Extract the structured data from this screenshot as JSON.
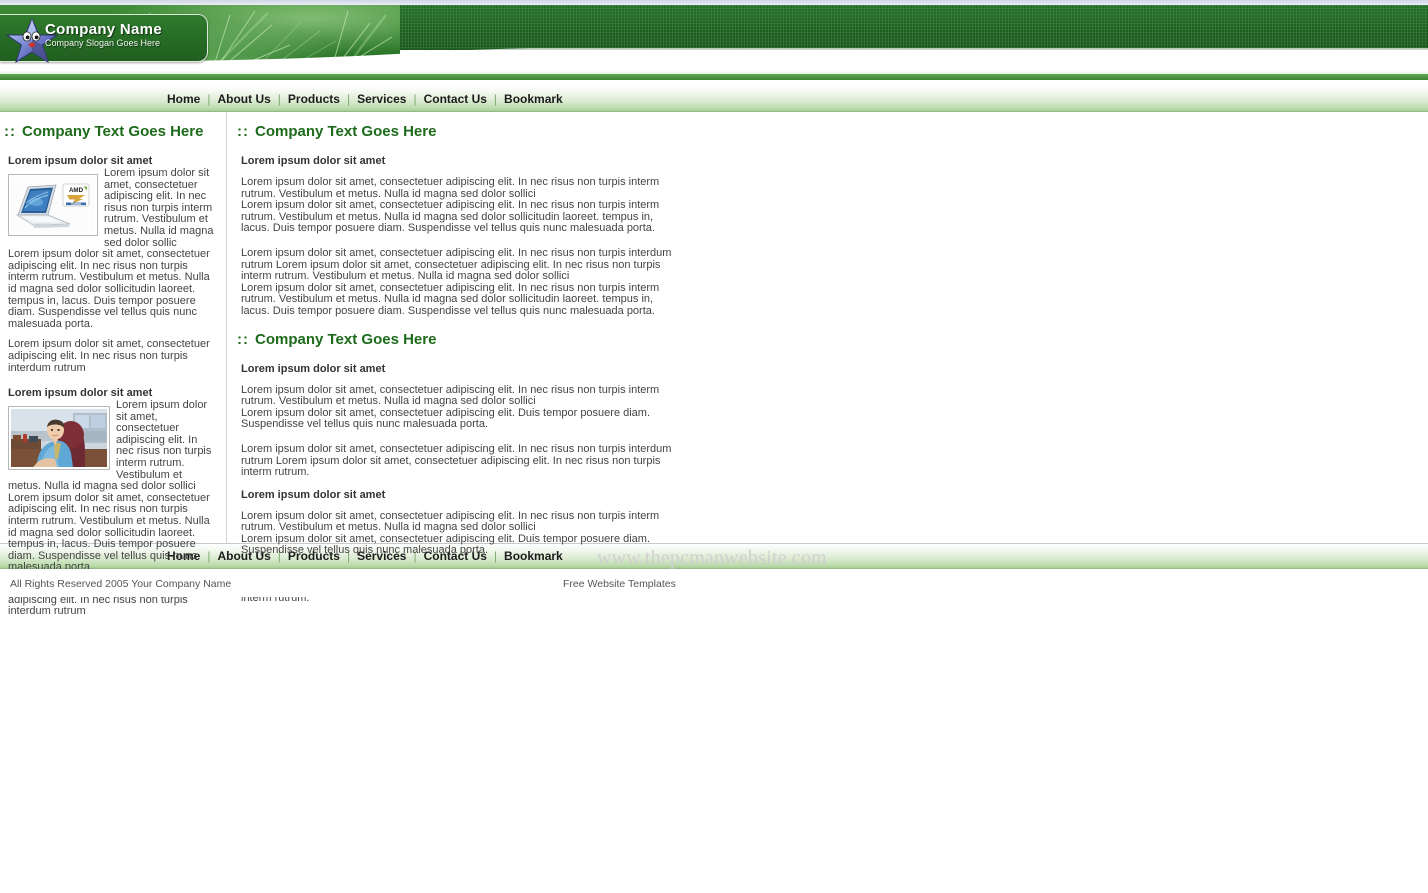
{
  "header": {
    "company_name": "Company Name",
    "company_slogan": "Company Slogan Goes Here",
    "logo_icon": "star-character-logo"
  },
  "nav": {
    "separator": "|",
    "items": [
      {
        "label": "Home"
      },
      {
        "label": "About Us"
      },
      {
        "label": "Products"
      },
      {
        "label": "Services"
      },
      {
        "label": "Contact Us"
      },
      {
        "label": "Bookmark"
      }
    ]
  },
  "left_column": {
    "section_heading": {
      "colons": "::",
      "text": "Company Text Goes Here"
    },
    "block1": {
      "sub_title": "Lorem ipsum dolor sit amet",
      "image_alt": "laptop-with-amd-turion-badge",
      "wrap_text": "Lorem ipsum dolor sit amet, consectetuer adipiscing elit. In nec risus non turpis interm rutrum. Vestibulum et metus. Nulla id magna sed dolor sollic",
      "body_text": "Lorem ipsum dolor sit amet, consectetuer adipiscing elit. In nec risus non turpis interm rutrum. Vestibulum et metus. Nulla id magna sed dolor sollicitudin laoreet. tempus in, lacus. Duis tempor posuere diam. Suspendisse vel tellus quis nunc malesuada porta.",
      "tail_text": "Lorem ipsum dolor sit amet, consectetuer adipiscing elit. In nec risus non turpis interdum rutrum"
    },
    "block2": {
      "sub_title": "Lorem ipsum dolor sit amet",
      "image_alt": "businessman-at-desk",
      "wrap_text": "Lorem ipsum dolor sit amet, consectetuer adipiscing elit. In nec risus non turpis interm rutrum. Vestibulum et metus. Nulla id magna sed dolor sollici",
      "body_text": "Lorem ipsum dolor sit amet, consectetuer adipiscing elit. In nec risus non turpis interm rutrum. Vestibulum et metus. Nulla id magna sed dolor sollicitudin laoreet. tempus in, lacus. Duis tempor posuere diam. Suspendisse vel tellus quis nunc malesuada porta.",
      "tail_text": "Lorem ipsum dolor sit amet, consectetuer adipiscing elit. In nec risus non turpis interdum rutrum"
    }
  },
  "right_column": {
    "section1": {
      "heading": {
        "colons": "::",
        "text": "Company Text Goes Here"
      },
      "sub_title": "Lorem ipsum dolor sit amet",
      "para1": "Lorem ipsum dolor sit amet, consectetuer adipiscing elit. In nec risus non turpis interm rutrum. Vestibulum et metus. Nulla id magna sed dolor sollici",
      "para2": "Lorem ipsum dolor sit amet, consectetuer adipiscing elit. In nec risus non turpis interm rutrum. Vestibulum et metus. Nulla id magna sed dolor sollicitudin laoreet. tempus in, lacus. Duis tempor posuere diam. Suspendisse vel tellus quis nunc malesuada porta.",
      "para3": "Lorem ipsum dolor sit amet, consectetuer adipiscing elit. In nec risus non turpis interdum rutrum Lorem ipsum dolor sit amet, consectetuer adipiscing elit. In nec risus non turpis interm rutrum. Vestibulum et metus. Nulla id magna sed dolor sollici",
      "para4": "Lorem ipsum dolor sit amet, consectetuer adipiscing elit. In nec risus non turpis interm rutrum. Vestibulum et metus. Nulla id magna sed dolor sollicitudin laoreet. tempus in, lacus. Duis tempor posuere diam. Suspendisse vel tellus quis nunc malesuada porta."
    },
    "section2": {
      "heading": {
        "colons": "::",
        "text": "Company Text Goes Here"
      },
      "block1": {
        "sub_title": "Lorem ipsum dolor sit amet",
        "para1": "Lorem ipsum dolor sit amet, consectetuer adipiscing elit. In nec risus non turpis interm rutrum. Vestibulum et metus. Nulla id magna sed dolor sollici",
        "para2": "Lorem ipsum dolor sit amet, consectetuer adipiscing elit. Duis tempor posuere diam. Suspendisse vel tellus quis nunc malesuada porta.",
        "para3": "Lorem ipsum dolor sit amet, consectetuer adipiscing elit. In nec risus non turpis interdum rutrum Lorem ipsum dolor sit amet, consectetuer adipiscing elit. In nec risus non turpis interm rutrum."
      },
      "block2": {
        "sub_title": "Lorem ipsum dolor sit amet",
        "para1": "Lorem ipsum dolor sit amet, consectetuer adipiscing elit. In nec risus non turpis interm rutrum. Vestibulum et metus. Nulla id magna sed dolor sollici",
        "para2": "Lorem ipsum dolor sit amet, consectetuer adipiscing elit. Duis tempor posuere diam. Suspendisse vel tellus quis nunc malesuada porta.",
        "para3": "Lorem ipsum dolor sit amet, consectetuer adipiscing elit. In nec risus non turpis interdum rutrum Lorem ipsum dolor sit amet, consectetuer adipiscing elit. In nec risus non turpis interm rutrum."
      }
    }
  },
  "watermark": {
    "text": "www.thepcmanwebsite.com"
  },
  "footer": {
    "copyright": "All Rights Reserved 2005 Your Company Name",
    "credit": "Free Website Templates"
  },
  "colors": {
    "heading_green": "#1d6b1b",
    "banner_dark_green": "#1f6220",
    "nav_green": "#a3cd90",
    "body_text": "#444444",
    "watermark_gray": "#cfcfcf"
  }
}
